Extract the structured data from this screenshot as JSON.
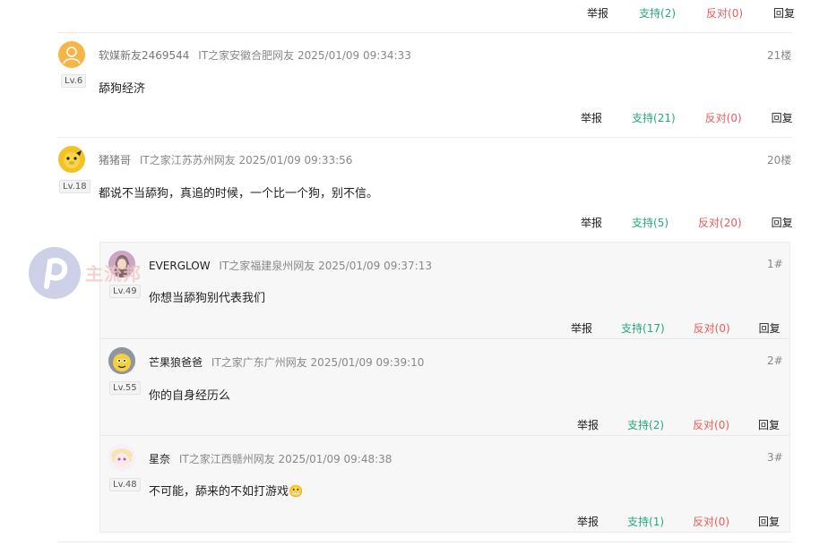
{
  "top_actions": {
    "report": "举报",
    "support": "支持(2)",
    "oppose": "反对(0)",
    "reply": "回复"
  },
  "comments": [
    {
      "username": "软媒新友2469544",
      "location": "IT之家安徽合肥网友",
      "time": "2025/01/09 09:34:33",
      "floor": "21楼",
      "level": "Lv.6",
      "text": "舔狗经济",
      "actions": {
        "report": "举报",
        "support": "支持(21)",
        "oppose": "反对(0)",
        "reply": "回复"
      }
    },
    {
      "username": "猪猪哥",
      "location": "IT之家江苏苏州网友",
      "time": "2025/01/09 09:33:56",
      "floor": "20楼",
      "level": "Lv.18",
      "text": "都说不当舔狗，真追的时候，一个比一个狗，别不信。",
      "actions": {
        "report": "举报",
        "support": "支持(5)",
        "oppose": "反对(20)",
        "reply": "回复"
      },
      "replies": [
        {
          "username": "EVERGLOW",
          "location": "IT之家福建泉州网友",
          "time": "2025/01/09 09:37:13",
          "floor": "1#",
          "level": "Lv.49",
          "text": "你想当舔狗别代表我们",
          "actions": {
            "report": "举报",
            "support": "支持(17)",
            "oppose": "反对(0)",
            "reply": "回复"
          }
        },
        {
          "username": "芒果狼爸爸",
          "location": "IT之家广东广州网友",
          "time": "2025/01/09 09:39:10",
          "floor": "2#",
          "level": "Lv.55",
          "text": "你的自身经历么",
          "actions": {
            "report": "举报",
            "support": "支持(2)",
            "oppose": "反对(0)",
            "reply": "回复"
          }
        },
        {
          "username": "星奈",
          "location": "IT之家江西赣州网友",
          "time": "2025/01/09 09:48:38",
          "floor": "3#",
          "level": "Lv.48",
          "text": "不可能，舔来的不如打游戏",
          "emoji": "😬",
          "actions": {
            "report": "举报",
            "support": "支持(1)",
            "oppose": "反对(0)",
            "reply": "回复"
          }
        }
      ]
    }
  ],
  "watermark": "主流邦",
  "colors": {
    "support": "#27a87a",
    "oppose": "#ee5a5a",
    "box_bg": "#f7f7f7"
  }
}
